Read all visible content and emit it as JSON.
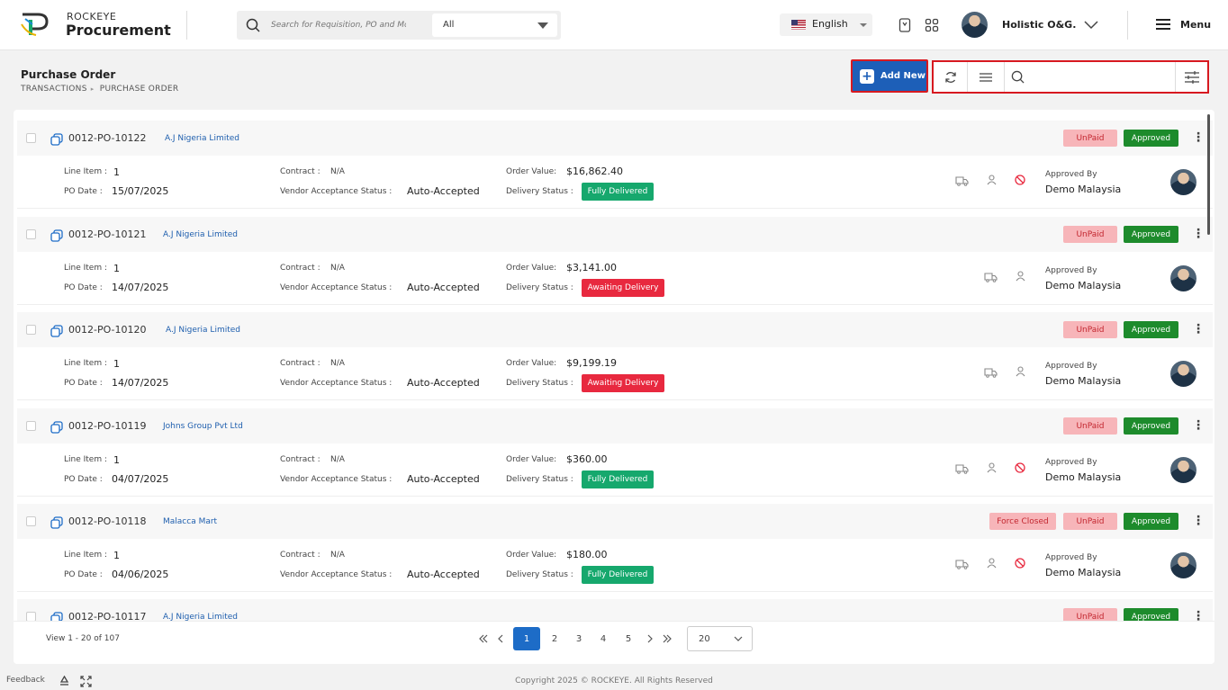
{
  "header": {
    "brand_small": "ROCKEYE",
    "brand_big": "Procurement",
    "search_placeholder": "Search for Requisition, PO and Mc",
    "search_scope": "All",
    "language": "English",
    "user_name": "Holistic O&G.",
    "menu_label": "Menu"
  },
  "page": {
    "title": "Purchase Order",
    "breadcrumb": [
      "TRANSACTIONS",
      "PURCHASE ORDER"
    ],
    "add_new_label": "Add New",
    "search_placeholder": ""
  },
  "labels": {
    "line_item": "Line Item :",
    "po_date": "PO Date :",
    "contract": "Contract :",
    "vendor_acceptance": "Vendor Acceptance Status :",
    "order_value": "Order Value:",
    "delivery_status": "Delivery Status :",
    "approved_by": "Approved By"
  },
  "orders": [
    {
      "po": "0012-PO-10122",
      "vendor": "A.J Nigeria Limited",
      "line_item": "1",
      "po_date": "15/07/2025",
      "contract": "N/A",
      "vendor_status": "Auto-Accepted",
      "order_value": "$16,862.40",
      "delivery": "Fully Delivered",
      "payment": "UnPaid",
      "approval": "Approved",
      "approved_by": "Demo Malaysia",
      "force_closed": ""
    },
    {
      "po": "0012-PO-10121",
      "vendor": "A.J Nigeria Limited",
      "line_item": "1",
      "po_date": "14/07/2025",
      "contract": "N/A",
      "vendor_status": "Auto-Accepted",
      "order_value": "$3,141.00",
      "delivery": "Awaiting Delivery",
      "payment": "UnPaid",
      "approval": "Approved",
      "approved_by": "Demo Malaysia",
      "force_closed": ""
    },
    {
      "po": "0012-PO-10120",
      "vendor": "A.J Nigeria Limited",
      "line_item": "1",
      "po_date": "14/07/2025",
      "contract": "N/A",
      "vendor_status": "Auto-Accepted",
      "order_value": "$9,199.19",
      "delivery": "Awaiting Delivery",
      "payment": "UnPaid",
      "approval": "Approved",
      "approved_by": "Demo Malaysia",
      "force_closed": ""
    },
    {
      "po": "0012-PO-10119",
      "vendor": "Johns Group Pvt Ltd",
      "line_item": "1",
      "po_date": "04/07/2025",
      "contract": "N/A",
      "vendor_status": "Auto-Accepted",
      "order_value": "$360.00",
      "delivery": "Fully Delivered",
      "payment": "UnPaid",
      "approval": "Approved",
      "approved_by": "Demo Malaysia",
      "force_closed": ""
    },
    {
      "po": "0012-PO-10118",
      "vendor": "Malacca Mart",
      "line_item": "1",
      "po_date": "04/06/2025",
      "contract": "N/A",
      "vendor_status": "Auto-Accepted",
      "order_value": "$180.00",
      "delivery": "Fully Delivered",
      "payment": "UnPaid",
      "approval": "Approved",
      "approved_by": "Demo Malaysia",
      "force_closed": "Force Closed"
    },
    {
      "po": "0012-PO-10117",
      "vendor": "A.J Nigeria Limited",
      "payment": "UnPaid",
      "approval": "Approved"
    }
  ],
  "pagination": {
    "view_text": "View 1 - 20 of 107",
    "pages": [
      "1",
      "2",
      "3",
      "4",
      "5"
    ],
    "active_page": "1",
    "page_size": "20"
  },
  "footer": {
    "feedback": "Feedback",
    "copyright": "Copyright 2025 © ROCKEYE. All Rights Reserved"
  },
  "colors": {
    "primary": "#1d5fb8",
    "approved": "#1d8b2c",
    "unpaid_bg": "#f7b5b9",
    "fully_delivered": "#16a86d",
    "awaiting_delivery": "#e8293f",
    "highlight_border": "#d71920"
  }
}
